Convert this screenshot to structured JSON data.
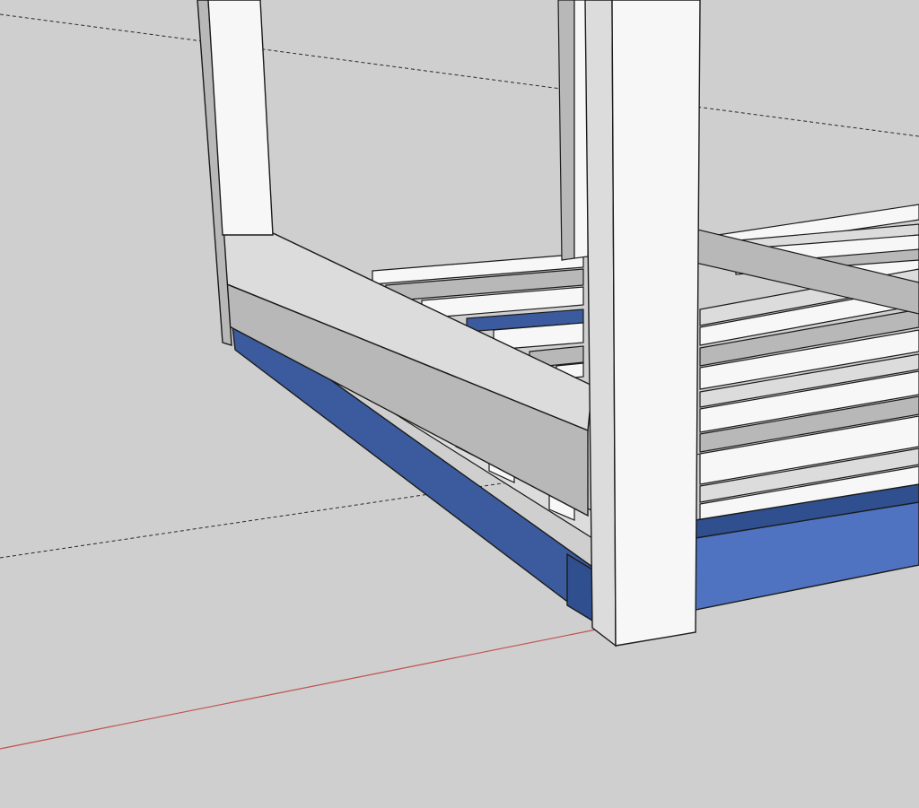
{
  "viewport": {
    "background_color": "#cfcfcf",
    "edge_color": "#1b1b1b",
    "red_axis_color": "#c0504d",
    "guide_color": "#2a2a2a"
  },
  "scene": {
    "objects": [
      "left-post",
      "right-post",
      "back-post",
      "side-rail",
      "back-rail",
      "slats",
      "blue-side-board",
      "blue-front-board"
    ],
    "colors": {
      "wood_light": "#f7f7f7",
      "wood_mid": "#dcdcdc",
      "wood_shadow": "#b8b8b8",
      "wood_dark": "#9a9a9a",
      "blue_light": "#4f73c0",
      "blue_dark": "#3b5b9e",
      "blue_deep": "#2f4f8f"
    }
  }
}
